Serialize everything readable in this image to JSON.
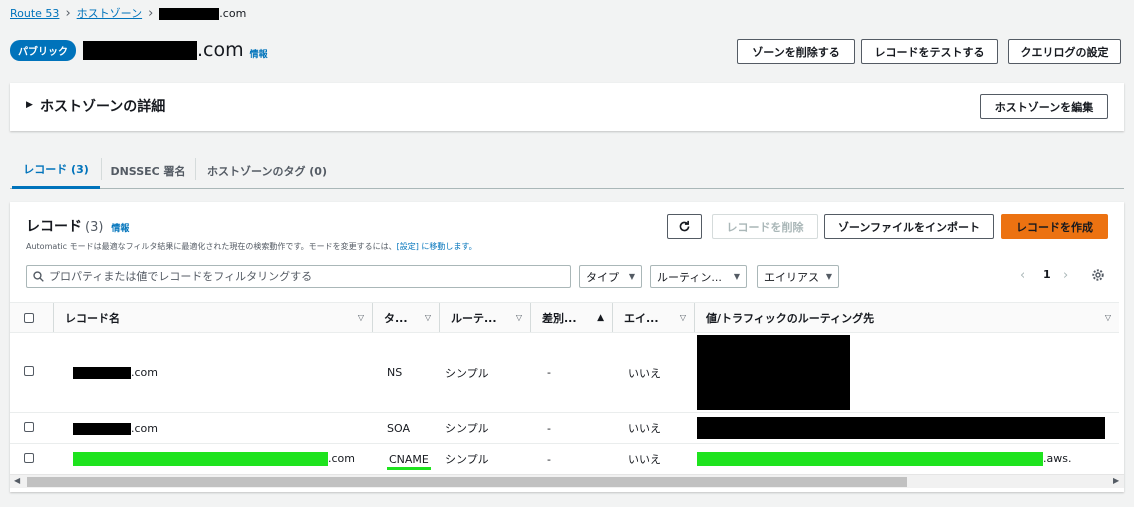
{
  "breadcrumb": {
    "root": "Route 53",
    "zones": "ホストゾーン",
    "current_suffix": ".com"
  },
  "header": {
    "badge": "パブリック",
    "title_suffix": ".com",
    "info": "情報"
  },
  "actions": {
    "delete_zone": "ゾーンを削除する",
    "test_record": "レコードをテストする",
    "query_log": "クエリログの設定"
  },
  "details": {
    "title": "ホストゾーンの詳細",
    "edit": "ホストゾーンを編集"
  },
  "tabs": [
    {
      "label": "レコード (3)"
    },
    {
      "label": "DNSSEC 署名"
    },
    {
      "label": "ホストゾーンのタグ (0)"
    }
  ],
  "records": {
    "title": "レコード",
    "count": "(3)",
    "info": "情報",
    "desc_main": "Automatic モードは最適なフィルタ結果に最適化された現在の検索動作です。モードを変更するには、",
    "desc_link": "[設定] に移動します。",
    "delete_btn": "レコードを削除",
    "import_btn": "ゾーンファイルをインポート",
    "create_btn": "レコードを作成",
    "search_placeholder": "プロパティまたは値でレコードをフィルタリングする",
    "filter_type": "タイプ",
    "filter_routing": "ルーティン...",
    "filter_alias": "エイリアス",
    "page": "1",
    "columns": [
      "レコード名",
      "タ...",
      "ルーテ...",
      "差別...",
      "エイ...",
      "値/トラフィックのルーティング先"
    ],
    "rows": [
      {
        "name_suffix": ".com",
        "type": "NS",
        "routing": "シンプル",
        "diff": "-",
        "alias": "いいえ",
        "value_suffix": ""
      },
      {
        "name_suffix": ".com",
        "type": "SOA",
        "routing": "シンプル",
        "diff": "-",
        "alias": "いいえ",
        "value_suffix": ""
      },
      {
        "name_suffix": ".com",
        "type": "CNAME",
        "routing": "シンプル",
        "diff": "-",
        "alias": "いいえ",
        "value_suffix": ".aws."
      }
    ]
  }
}
